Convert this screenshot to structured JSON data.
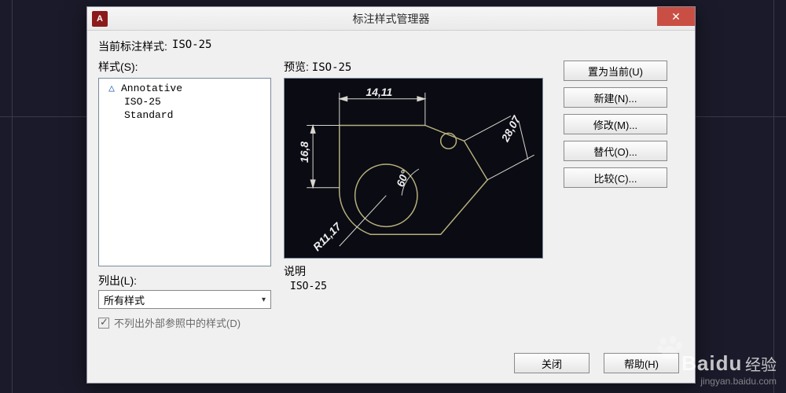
{
  "dialog": {
    "title": "标注样式管理器",
    "app_icon_letter": "A"
  },
  "current_style": {
    "label": "当前标注样式:",
    "value": "ISO-25"
  },
  "styles": {
    "label": "样式(S):",
    "items": [
      {
        "label": "Annotative",
        "has_icon": true,
        "selected": false
      },
      {
        "label": "ISO-25",
        "has_icon": false,
        "selected": true
      },
      {
        "label": "Standard",
        "has_icon": false,
        "selected": false
      }
    ]
  },
  "list_out": {
    "label": "列出(L):",
    "selected": "所有样式"
  },
  "checkbox": {
    "label": "不列出外部参照中的样式(D)",
    "checked": true
  },
  "preview": {
    "label": "预览:",
    "style_name": "ISO-25",
    "dims": {
      "top": "14,11",
      "left": "16,8",
      "diag": "28,07",
      "angle": "60°",
      "radius": "R11,17"
    }
  },
  "description": {
    "label": "说明",
    "text": "ISO-25"
  },
  "buttons": {
    "set_current": "置为当前(U)",
    "new": "新建(N)...",
    "modify": "修改(M)...",
    "override": "替代(O)...",
    "compare": "比较(C)..."
  },
  "footer": {
    "close": "关闭",
    "help": "帮助(H)"
  },
  "watermark": {
    "brand": "Baidu",
    "cn": "经验",
    "url": "jingyan.baidu.com"
  }
}
